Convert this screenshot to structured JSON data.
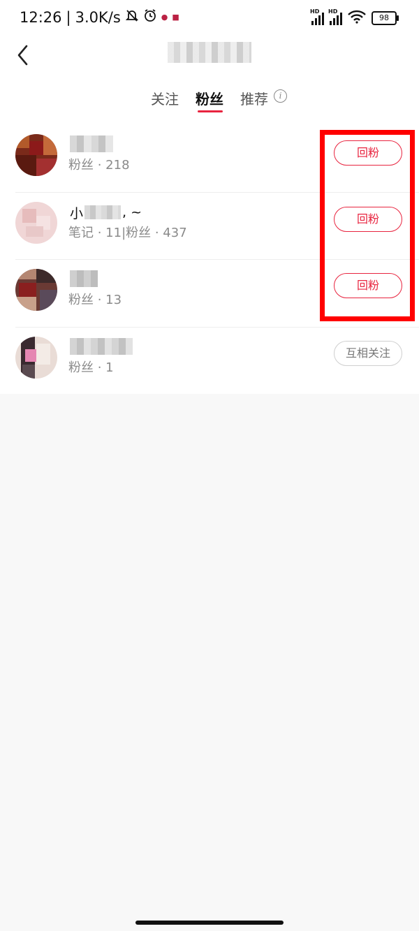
{
  "status_bar": {
    "time": "12:26",
    "speed": "3.0K/s",
    "battery": "98"
  },
  "tabs": [
    {
      "label": "关注"
    },
    {
      "label": "粉丝",
      "active": true
    },
    {
      "label": "推荐"
    }
  ],
  "followers": [
    {
      "name": "",
      "stats": "粉丝 · 218",
      "button": "回粉",
      "button_style": "red"
    },
    {
      "name_prefix": "小",
      "name_suffix": ", ~",
      "stats": "笔记 · 11|粉丝 · 437",
      "button": "回粉",
      "button_style": "red"
    },
    {
      "name": "",
      "stats": "粉丝 · 13",
      "button": "回粉",
      "button_style": "red"
    },
    {
      "name": "",
      "stats": "粉丝 · 1",
      "button": "互相关注",
      "button_style": "gray"
    }
  ],
  "colors": {
    "accent": "#e8243f",
    "highlight": "#ff0000"
  }
}
